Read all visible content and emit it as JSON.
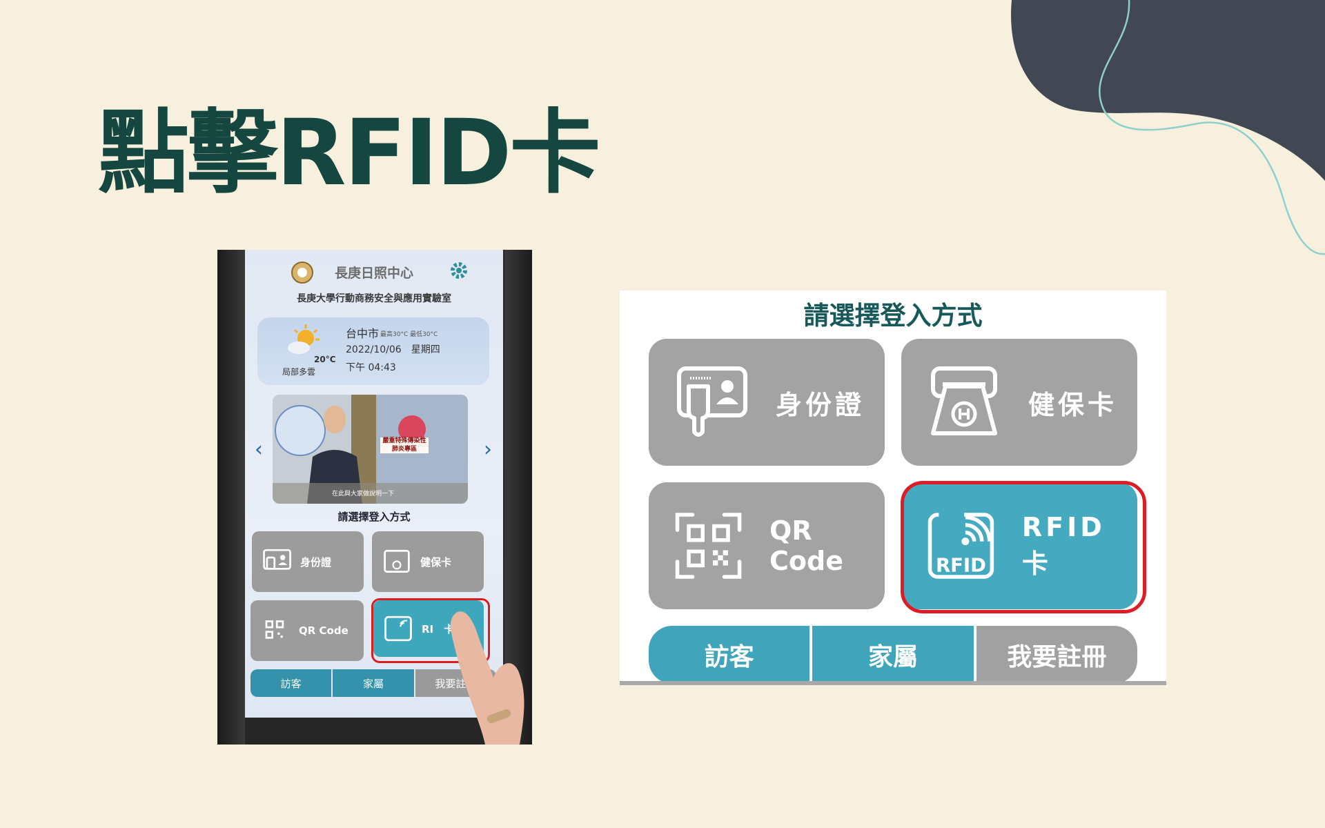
{
  "slide": {
    "title": "點擊RFID卡"
  },
  "phone": {
    "app_name": "長庚日照中心",
    "lab_name": "長庚大學行動商務安全與應用實驗室",
    "weather": {
      "city": "台中市",
      "range": "最高30°C  最低30°C",
      "date": "2022/10/06　星期四",
      "time": "下午 04:43",
      "temp": "20°C",
      "condition": "局部多雲"
    },
    "news": {
      "label": "嚴重特殊傳染性肺炎專區",
      "caption": "在此與大家做說明一下"
    },
    "select_label": "請選擇登入方式",
    "buttons": {
      "id_card": "身份證",
      "health_card": "健保卡",
      "qr_code": "QR Code",
      "rfid": "RI　卡"
    },
    "tabs": [
      "訪客",
      "家屬",
      "我要註冊"
    ]
  },
  "panel": {
    "title": "請選擇登入方式",
    "buttons": {
      "id_card": "身份證",
      "health_card": "健保卡",
      "qr_code": "QR Code",
      "rfid": "RFID 卡"
    },
    "rfid_icon_text": "RFID",
    "tabs": [
      "訪客",
      "家屬",
      "我要註冊"
    ]
  },
  "colors": {
    "background": "#f7f0df",
    "title": "#15463f",
    "teal": "#45a9bf",
    "gray": "#a3a3a3",
    "highlight": "#de1c25",
    "blob": "#414753"
  }
}
